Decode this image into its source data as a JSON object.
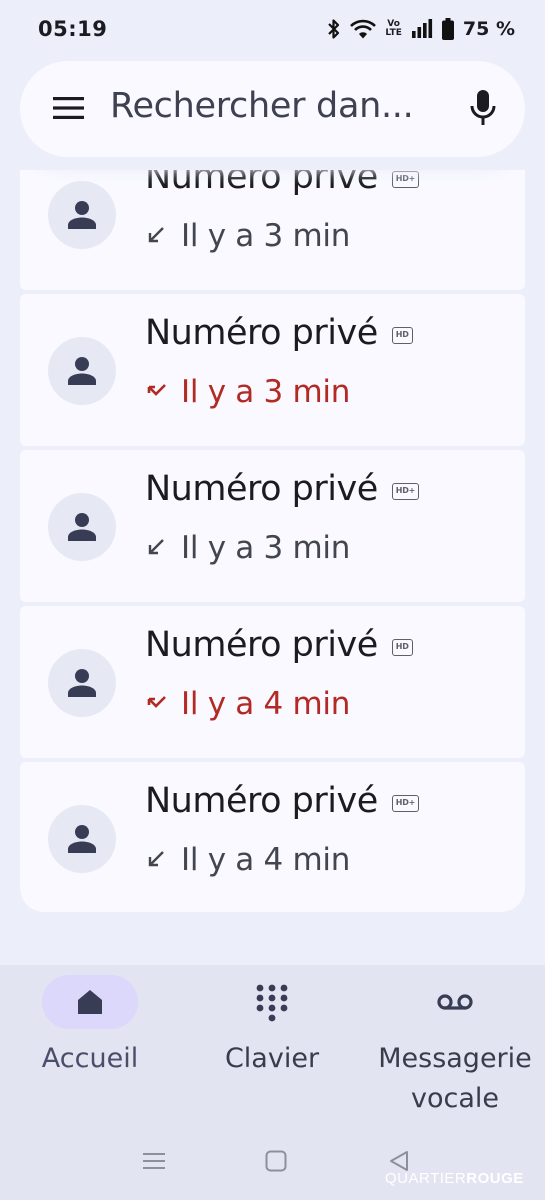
{
  "status_bar": {
    "time": "05:19",
    "volte_top": "Vo",
    "volte_bottom": "LTE",
    "battery": "75 %"
  },
  "search": {
    "placeholder": "Rechercher dan..."
  },
  "calls": [
    {
      "name": "Numéro privé",
      "hd": "HD+",
      "time": "Il y a 3 min",
      "missed": false
    },
    {
      "name": "Numéro privé",
      "hd": "HD",
      "time": "Il y a 3 min",
      "missed": true
    },
    {
      "name": "Numéro privé",
      "hd": "HD+",
      "time": "Il y a 3 min",
      "missed": false
    },
    {
      "name": "Numéro privé",
      "hd": "HD",
      "time": "Il y a 4 min",
      "missed": true
    },
    {
      "name": "Numéro privé",
      "hd": "HD+",
      "time": "Il y a 4 min",
      "missed": false
    }
  ],
  "bottom_nav": {
    "home_label": "Accueil",
    "keypad_label": "Clavier",
    "voicemail_label_1": "Messagerie",
    "voicemail_label_2": "vocale"
  },
  "watermark": {
    "part1": "QUARTIER",
    "part2": "ROUGE"
  },
  "colors": {
    "background": "#eceef9",
    "card": "#f9f9ff",
    "missed": "#b32a24",
    "active_pill": "#dcd8fb"
  },
  "icons": [
    "menu-icon",
    "mic-icon",
    "person-icon",
    "incoming-call-icon",
    "missed-call-icon",
    "home-icon",
    "dialpad-icon",
    "voicemail-icon"
  ]
}
